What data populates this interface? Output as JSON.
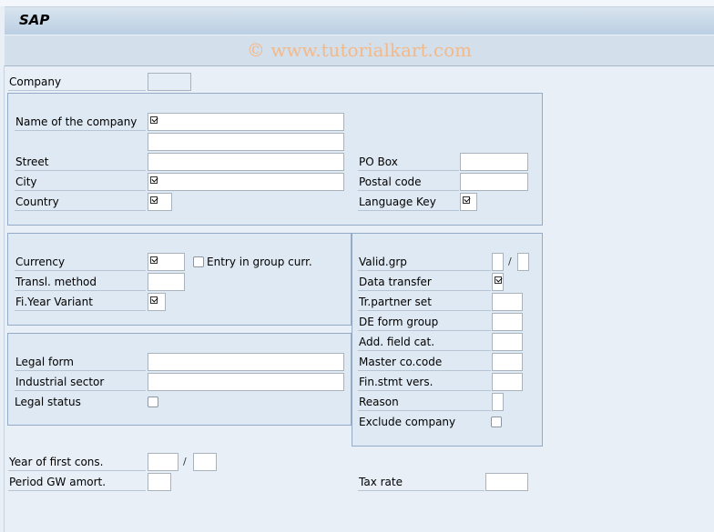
{
  "window": {
    "title": "SAP",
    "watermark": "© www.tutorialkart.com"
  },
  "company": {
    "label": "Company",
    "value": ""
  },
  "address": {
    "name_label": "Name of the company",
    "name_value": "",
    "name2_value": "",
    "street_label": "Street",
    "street_value": "",
    "city_label": "City",
    "city_value": "",
    "country_label": "Country",
    "country_value": "",
    "pobox_label": "PO Box",
    "pobox_value": "",
    "postal_label": "Postal code",
    "postal_value": "",
    "langkey_label": "Language Key",
    "langkey_value": ""
  },
  "currency_group": {
    "currency_label": "Currency",
    "currency_value": "",
    "entry_group_curr_label": "Entry in group curr.",
    "entry_group_curr_checked": false,
    "transl_label": "Transl. method",
    "transl_value": "",
    "fyv_label": "Fi.Year Variant",
    "fyv_value": ""
  },
  "legal_group": {
    "legal_form_label": "Legal form",
    "legal_form_value": "",
    "industrial_label": "Industrial sector",
    "industrial_value": "",
    "legal_status_label": "Legal status",
    "legal_status_checked": false
  },
  "right_group": {
    "valid_grp_label": "Valid.grp",
    "valid_grp_sep": "/",
    "data_transfer_label": "Data transfer",
    "tr_partner_label": "Tr.partner set",
    "de_form_label": "DE form group",
    "add_field_label": "Add. field cat.",
    "master_co_label": "Master co.code",
    "fin_stmt_label": "Fin.stmt vers.",
    "reason_label": "Reason",
    "exclude_label": "Exclude company",
    "exclude_checked": false
  },
  "bottom": {
    "year_first_label": "Year of first cons.",
    "year_sep": "/",
    "period_gw_label": "Period GW amort.",
    "tax_rate_label": "Tax rate"
  }
}
